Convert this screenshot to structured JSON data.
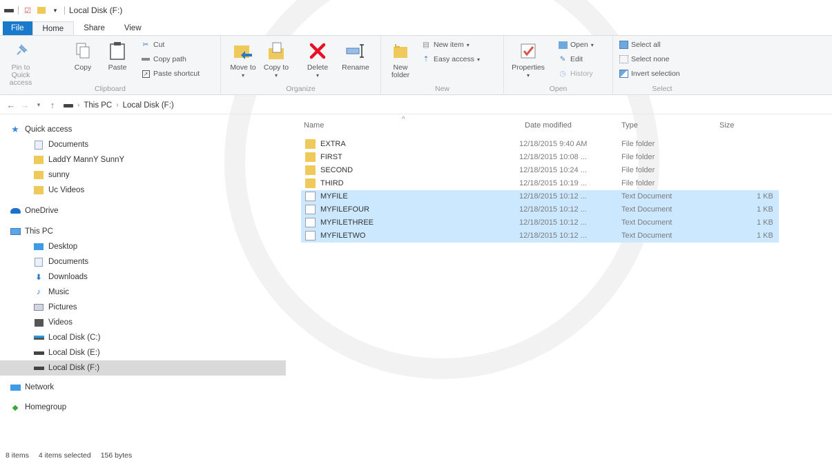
{
  "window": {
    "title": "Local Disk (F:)"
  },
  "ribbon_tabs": [
    "File",
    "Home",
    "Share",
    "View"
  ],
  "ribbon": {
    "clipboard": {
      "label": "Clipboard",
      "pin_to_quick_access": "Pin to Quick access",
      "copy": "Copy",
      "paste": "Paste",
      "cut": "Cut",
      "copy_path": "Copy path",
      "paste_shortcut": "Paste shortcut"
    },
    "organize": {
      "label": "Organize",
      "move_to": "Move to",
      "copy_to": "Copy to",
      "delete": "Delete",
      "rename": "Rename"
    },
    "new": {
      "label": "New",
      "new_folder": "New folder",
      "new_item": "New item",
      "easy_access": "Easy access"
    },
    "open": {
      "label": "Open",
      "properties": "Properties",
      "open": "Open",
      "edit": "Edit",
      "history": "History"
    },
    "select": {
      "label": "Select",
      "select_all": "Select all",
      "select_none": "Select none",
      "invert_selection": "Invert selection"
    }
  },
  "address": {
    "crumbs": [
      "This PC",
      "Local Disk (F:)"
    ]
  },
  "nav": {
    "quick_access": "Quick access",
    "quick_items": [
      "Documents",
      "LaddY MannY SunnY",
      "sunny",
      "Uc Videos"
    ],
    "onedrive": "OneDrive",
    "this_pc": "This PC",
    "pc_items": [
      "Desktop",
      "Documents",
      "Downloads",
      "Music",
      "Pictures",
      "Videos",
      "Local Disk (C:)",
      "Local Disk (E:)",
      "Local Disk (F:)"
    ],
    "network": "Network",
    "homegroup": "Homegroup"
  },
  "columns": {
    "name": "Name",
    "date": "Date modified",
    "type": "Type",
    "size": "Size"
  },
  "files": [
    {
      "name": "EXTRA",
      "date": "12/18/2015 9:40 AM",
      "type": "File folder",
      "size": "",
      "kind": "folder",
      "selected": false
    },
    {
      "name": "FIRST",
      "date": "12/18/2015 10:08 ...",
      "type": "File folder",
      "size": "",
      "kind": "folder",
      "selected": false
    },
    {
      "name": "SECOND",
      "date": "12/18/2015 10:24 ...",
      "type": "File folder",
      "size": "",
      "kind": "folder",
      "selected": false
    },
    {
      "name": "THIRD",
      "date": "12/18/2015 10:19 ...",
      "type": "File folder",
      "size": "",
      "kind": "folder",
      "selected": false
    },
    {
      "name": "MYFILE",
      "date": "12/18/2015 10:12 ...",
      "type": "Text Document",
      "size": "1 KB",
      "kind": "doc",
      "selected": true
    },
    {
      "name": "MYFILEFOUR",
      "date": "12/18/2015 10:12 ...",
      "type": "Text Document",
      "size": "1 KB",
      "kind": "doc",
      "selected": true
    },
    {
      "name": "MYFILETHREE",
      "date": "12/18/2015 10:12 ...",
      "type": "Text Document",
      "size": "1 KB",
      "kind": "doc",
      "selected": true
    },
    {
      "name": "MYFILETWO",
      "date": "12/18/2015 10:12 ...",
      "type": "Text Document",
      "size": "1 KB",
      "kind": "doc",
      "selected": true
    }
  ],
  "status": {
    "items": "8 items",
    "selected": "4 items selected",
    "bytes": "156 bytes"
  },
  "colors": {
    "file_tab": "#1979ca",
    "selection": "#cce8ff",
    "folder": "#f0c95b",
    "delete_red": "#e81123"
  }
}
